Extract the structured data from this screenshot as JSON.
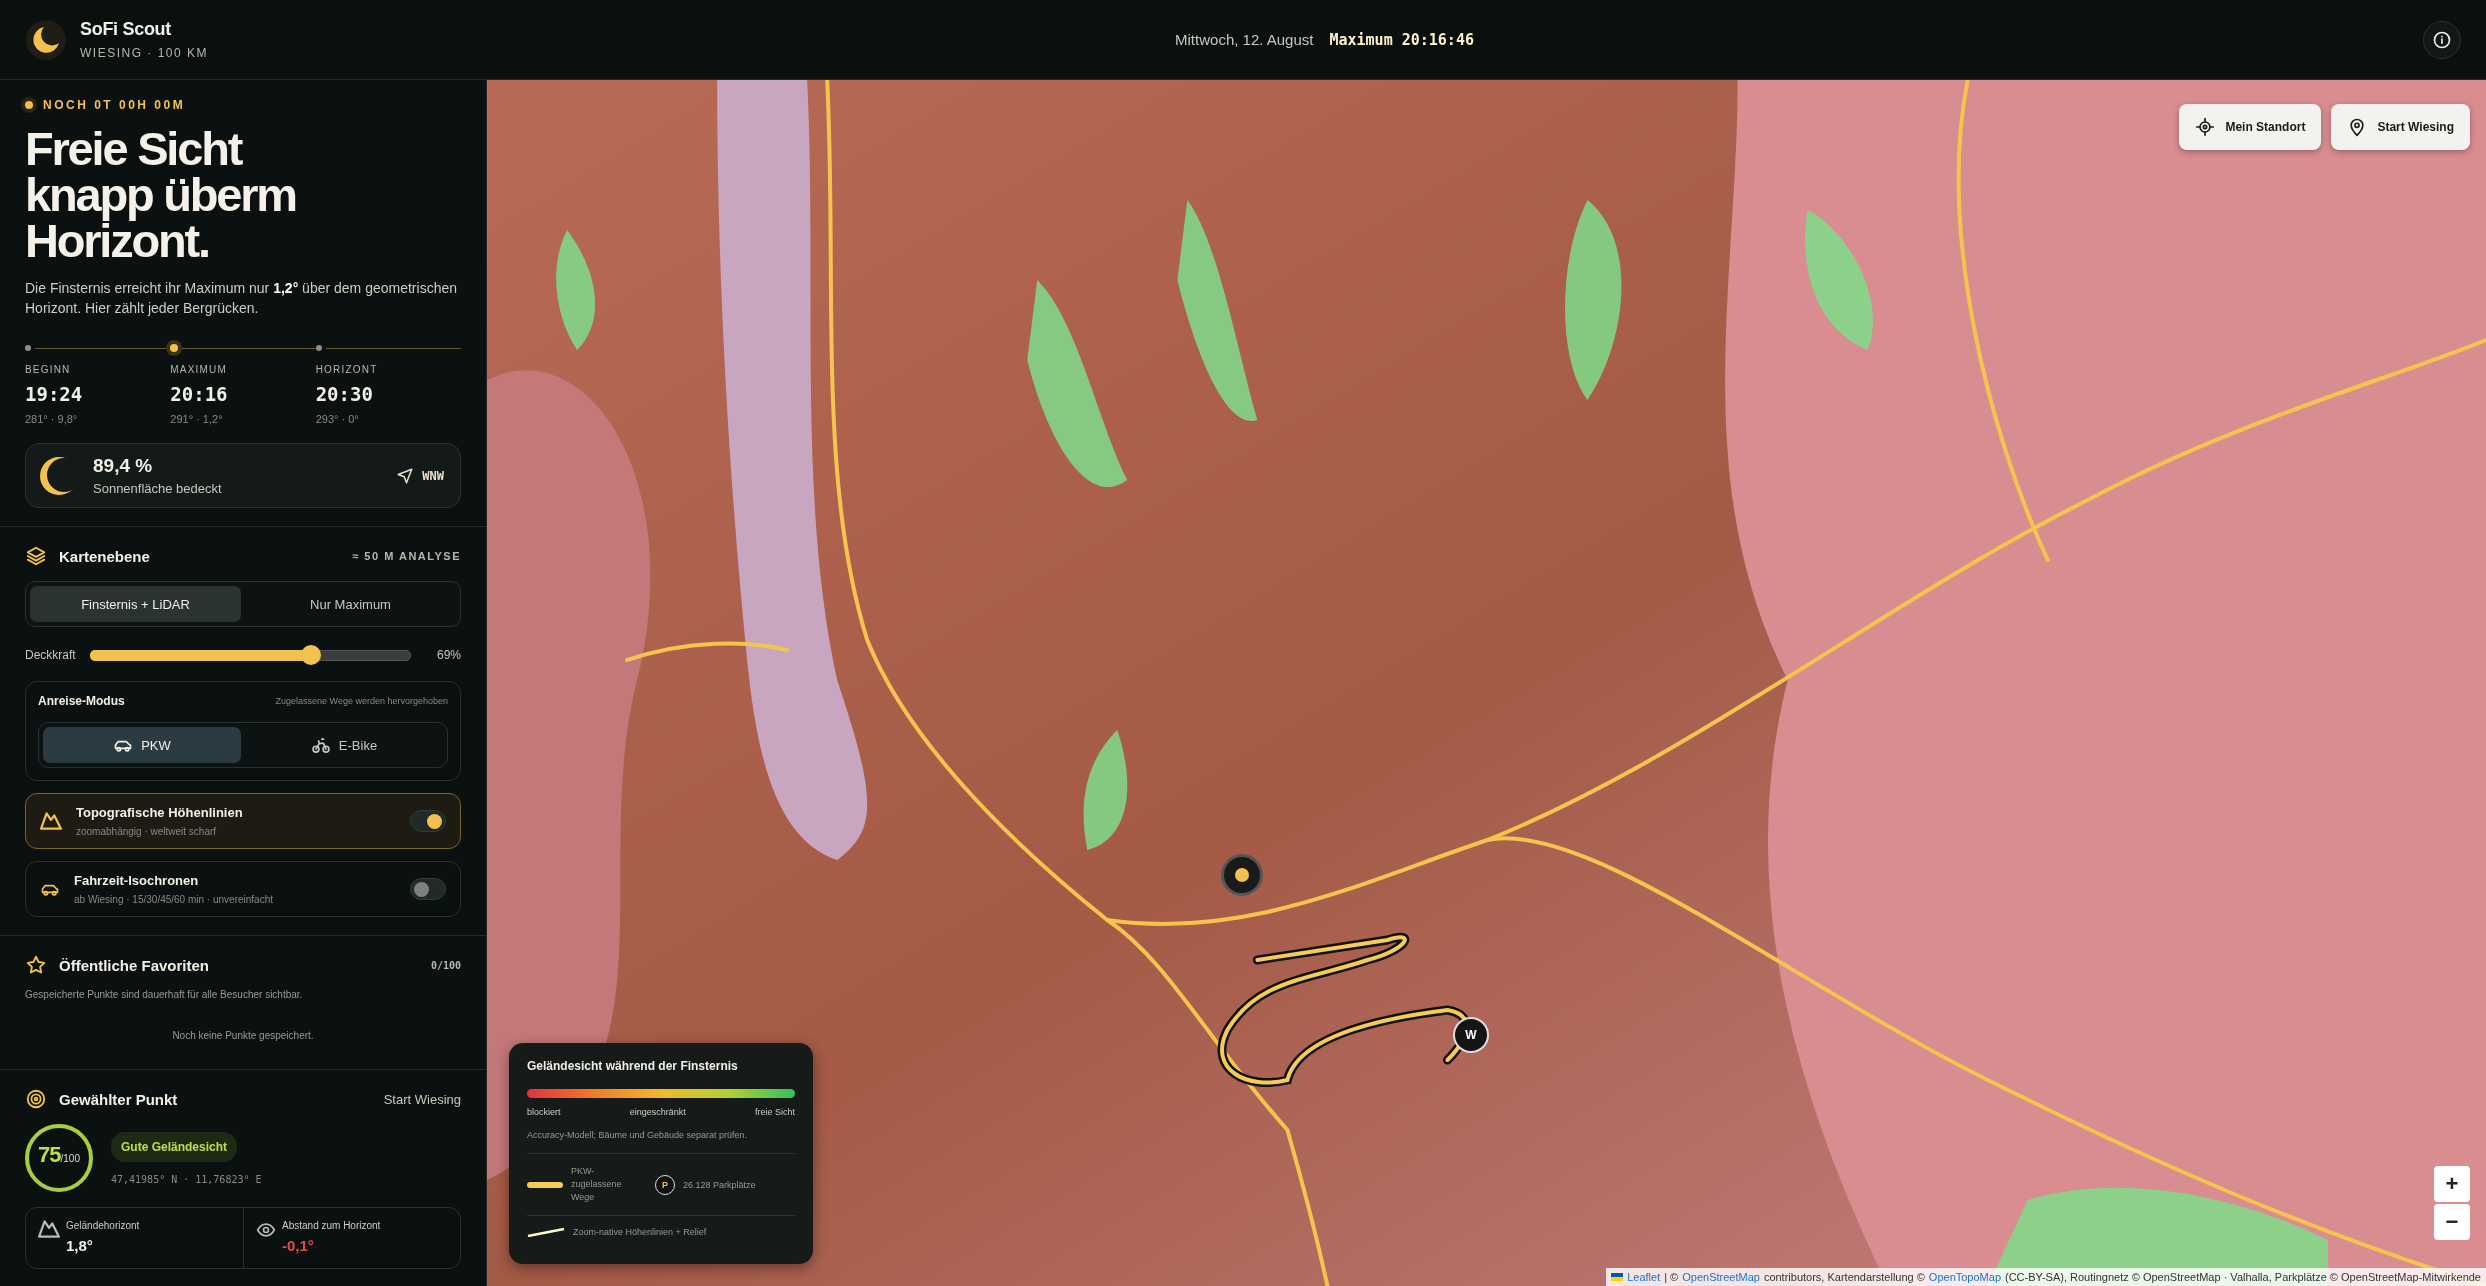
{
  "header": {
    "title": "SoFi Scout",
    "subtitle": "WIESING · 100 KM",
    "date": "Mittwoch, 12. August",
    "maximum": "Maximum 20:16:46"
  },
  "countdown": "NOCH 0T 00H 00M",
  "headline": "Freie Sicht knapp überm Horizont.",
  "intro": "Die Finsternis erreicht ihr Maximum nur **1,2°** über dem geometrischen Horizont. Hier zählt jeder Bergrücken.",
  "timeline": [
    {
      "label": "BEGINN",
      "time": "19:24",
      "detail": "281° · 9,8°",
      "selected": false
    },
    {
      "label": "MAXIMUM",
      "time": "20:16",
      "detail": "291° · 1,2°",
      "selected": true
    },
    {
      "label": "HORIZONT",
      "time": "20:30",
      "detail": "293° · 0°",
      "selected": false
    }
  ],
  "coverage": {
    "value": "89,4 %",
    "label": "Sonnenfläche bedeckt",
    "direction": "WNW"
  },
  "layer": {
    "title": "Kartenebene",
    "badge": "≈ 50 M ANALYSE",
    "modes": [
      {
        "label": "Finsternis + LiDAR",
        "selected": true
      },
      {
        "label": "Nur Maximum",
        "selected": false
      }
    ],
    "opacity": {
      "label": "Deckkraft",
      "level": 0.69,
      "reading": "69%"
    }
  },
  "travel": {
    "title": "Anreise-Modus",
    "hint": "Zugelassene Wege werden hervorgehoben",
    "modes": [
      {
        "label": "PKW",
        "kind": "car",
        "selected": true
      },
      {
        "label": "E-Bike",
        "kind": "bike",
        "selected": false
      }
    ]
  },
  "toggles": [
    {
      "kind": "mountain",
      "title": "Topografische Höhenlinien",
      "detail": "zoomabhängig · weltweit scharf",
      "on": true
    },
    {
      "kind": "car",
      "title": "Fahrzeit-Isochronen",
      "detail": "ab Wiesing · 15/30/45/60 min · unvereinfacht",
      "on": false
    }
  ],
  "favorites": {
    "title": "Öffentliche Favoriten",
    "count": "0/100",
    "description": "Gespeicherte Punkte sind dauerhaft für alle Besucher sichtbar.",
    "empty": "Noch keine Punkte gespeichert."
  },
  "point": {
    "title": "Gewählter Punkt",
    "location": "Start Wiesing",
    "score": "75",
    "score_max": "/100",
    "rating": "Gute Geländesicht",
    "coords": "47,41985° N · 11,76823° E",
    "stats": [
      {
        "kind": "mountain",
        "label": "Geländehorizont",
        "value": "1,8°",
        "color": "#f2efe6"
      },
      {
        "kind": "eye",
        "label": "Abstand zum Horizont",
        "value": "-0,1°",
        "color": "#e5484d"
      }
    ]
  },
  "map": {
    "buttons": [
      {
        "kind": "locate",
        "label": "Mein Standort"
      },
      {
        "kind": "pin",
        "label": "Start Wiesing"
      }
    ],
    "marker": "W",
    "zoom": [
      "+",
      "−"
    ]
  },
  "legend": {
    "title": "Geländesicht während der Finsternis",
    "scale": [
      "blockiert",
      "eingeschränkt",
      "freie Sicht"
    ],
    "note": "Accuracy-Modell; Bäume und Gebäude separat prüfen.",
    "items": [
      {
        "kind": "road",
        "label": "PKW-zugelassene Wege"
      },
      {
        "kind": "parking",
        "symbol": "P",
        "label": "26.128 Parkplätze"
      },
      {
        "kind": "contour",
        "label": "Zoom-native Höhenlinien + Relief"
      }
    ]
  },
  "attribution": [
    {
      "kind": "link",
      "text": "Leaflet"
    },
    {
      "kind": "text",
      "text": "| ©"
    },
    {
      "kind": "link",
      "text": "OpenStreetMap"
    },
    {
      "kind": "text",
      "text": "contributors, Kartendarstellung ©"
    },
    {
      "kind": "link",
      "text": "OpenTopoMap"
    },
    {
      "kind": "text",
      "text": "(CC-BY-SA), Routingnetz © OpenStreetMap · Valhalla, Parkplätze © OpenStreetMap-Mitwirkende"
    }
  ]
}
